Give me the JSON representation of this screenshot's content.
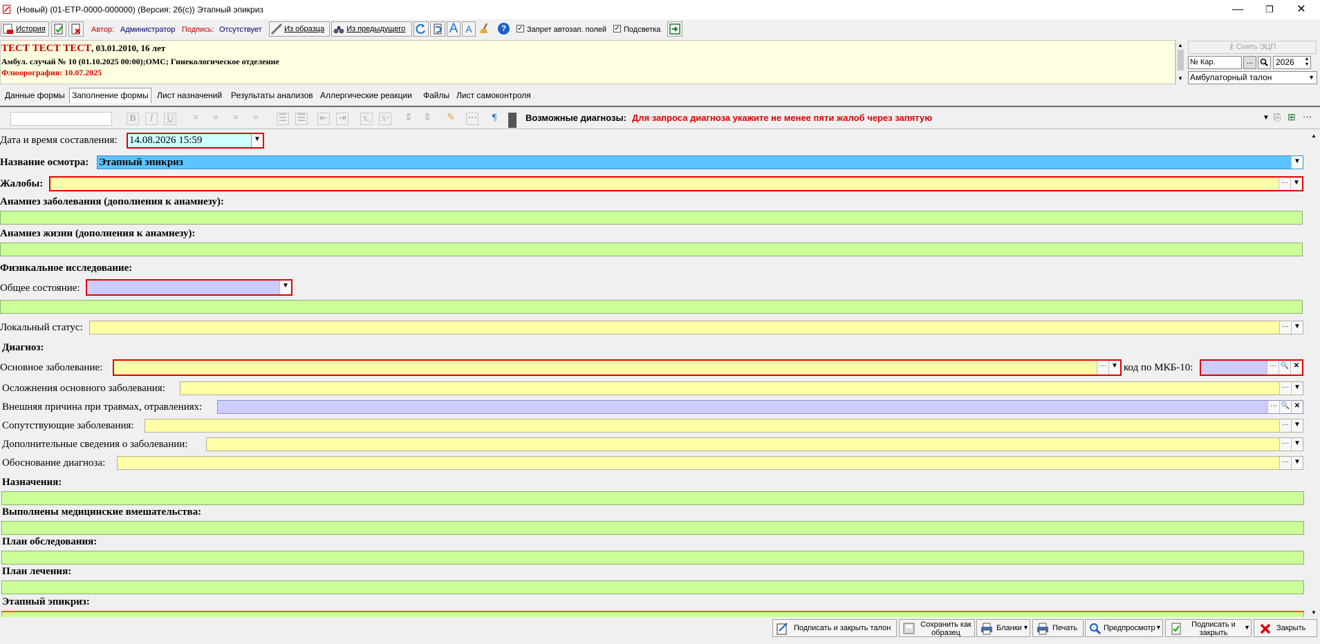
{
  "window": {
    "title": "(Новый) (01-ЕТР-0000-000000) (Версия: 26(с)) Этапный эпикриз",
    "minimize": "—",
    "maximize": "❐",
    "close": "✕"
  },
  "toolbar": {
    "history": "История",
    "author_label": "Автор:",
    "author_value": "Администратор",
    "sign_label": "Подпись:",
    "sign_value": "Отсутствует",
    "from_template": "Из образца",
    "from_previous": "Из предыдущего",
    "font_big": "A",
    "font_small": "A",
    "help": "?",
    "autofill_ban": "Запрет автозап. полей",
    "autofill_ban_checked": "✓",
    "highlight": "Подсветка",
    "highlight_checked": "✓"
  },
  "patient": {
    "name": "ТЕСТ ТЕСТ ТЕСТ",
    "dob_age": ", 03.01.2010, 16 лет",
    "case": "Амбул. случай  № 10 (01.10.2025 00:00);ОМС; Гинекологическое отделение",
    "fluoro": "Флюорография: 10.07.2025"
  },
  "right_panel": {
    "remove_sign": "Снять ЭЦП",
    "card_placeholder": "№ Кар.",
    "dots": "...",
    "year": "2026",
    "doc_type": "Амбулаторный талон"
  },
  "tabs": [
    {
      "label": "Данные формы"
    },
    {
      "label": "Заполнение формы"
    },
    {
      "label": "Лист назначений"
    },
    {
      "label": "Результаты анализов"
    },
    {
      "label": "Аллергические реакции"
    },
    {
      "label": "Файлы"
    },
    {
      "label": "Лист самоконтроля"
    }
  ],
  "editor": {
    "bold": "B",
    "italic": "I",
    "underline": "U",
    "subscript": "X₂",
    "superscript": "X²",
    "diag_label": "Возможные диагнозы:",
    "diag_hint": "Для запроса диагноза укажите не менее пяти жалоб через запятую"
  },
  "form": {
    "datetime_label": "Дата и время составления:",
    "datetime_value": "14.08.2026 15:59",
    "exam_name_label": "Название осмотра:",
    "exam_name_value": "Этапный эпикриз",
    "complaints_label": "Жалобы:",
    "anamnesis_disease_label": "Анамнез заболевания (дополнения к анамнезу):",
    "anamnesis_life_label": "Анамнез жизни (дополнения к анамнезу):",
    "physical_exam_label": "Физикальное исследование:",
    "general_state_label": "Общее состояние:",
    "local_status_label": "Локальный статус:",
    "diagnosis_label": "Диагноз:",
    "main_disease_label": "Основное заболевание:",
    "icd_label": "код по МКБ-10:",
    "complications_label": "Осложнения основного заболевания:",
    "external_cause_label": "Внешняя причина при травмах, отравлениях:",
    "comorbid_label": "Сопутствующие заболевания:",
    "additional_label": "Дополнительные сведения о заболевании:",
    "justification_label": "Обоснование диагноза:",
    "prescriptions_label": "Назначения:",
    "interventions_label": "Выполнены медицинские вмешательства:",
    "exam_plan_label": "План обследования:",
    "treatment_plan_label": "План лечения:",
    "epicrisis_label": "Этапный эпикриз:",
    "dots": "···",
    "arrow": "▼",
    "search": "🔍",
    "clear": "✕"
  },
  "bottom": {
    "sign_close_ticket": "Подписать и закрыть талон",
    "save_template_1": "Сохранить как",
    "save_template_2": "образец",
    "blanks": "Бланки",
    "print": "Печать",
    "preview": "Предпросмотр",
    "sign_close_1": "Подписать и",
    "sign_close_2": "закрыть",
    "close": "Закрыть"
  }
}
